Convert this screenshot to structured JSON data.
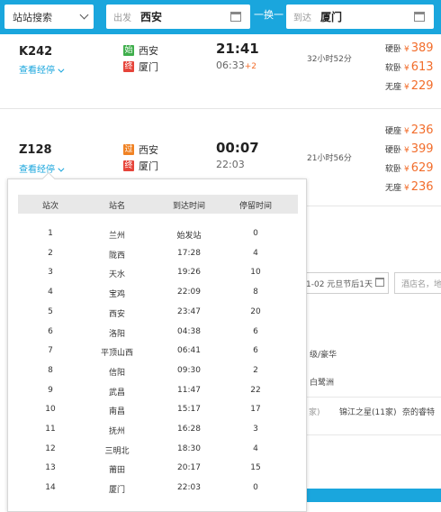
{
  "search": {
    "station_select": "站站搜索",
    "from_label": "出发",
    "from_city": "西安",
    "swap_label": "一换一",
    "to_label": "到达",
    "to_city": "厦门"
  },
  "trains": [
    {
      "code": "K242",
      "stops_link": "查看经停",
      "dep_badge": "始",
      "dep_badge_type": "start",
      "dep_station": "西安",
      "arr_badge": "终",
      "arr_station": "厦门",
      "dep_time": "21:41",
      "arr_time": "06:33",
      "day_offset": "+2",
      "duration": "32小时52分",
      "prices": [
        {
          "seat": "硬卧",
          "yen": "¥",
          "amount": "389"
        },
        {
          "seat": "软卧",
          "yen": "¥",
          "amount": "613"
        },
        {
          "seat": "无座",
          "yen": "¥",
          "amount": "229"
        }
      ]
    },
    {
      "code": "Z128",
      "stops_link": "查看经停",
      "dep_badge": "过",
      "dep_badge_type": "pass",
      "dep_station": "西安",
      "arr_badge": "终",
      "arr_station": "厦门",
      "dep_time": "00:07",
      "arr_time": "22:03",
      "day_offset": "",
      "duration": "21小时56分",
      "prices": [
        {
          "seat": "硬座",
          "yen": "¥",
          "amount": "236"
        },
        {
          "seat": "硬卧",
          "yen": "¥",
          "amount": "399"
        },
        {
          "seat": "软卧",
          "yen": "¥",
          "amount": "629"
        },
        {
          "seat": "无座",
          "yen": "¥",
          "amount": "236"
        }
      ]
    }
  ],
  "stops_popup": {
    "headers": [
      "站次",
      "站名",
      "到达时间",
      "停留时间"
    ],
    "rows": [
      [
        "1",
        "兰州",
        "始发站",
        "0"
      ],
      [
        "2",
        "陇西",
        "17:28",
        "4"
      ],
      [
        "3",
        "天水",
        "19:26",
        "10"
      ],
      [
        "4",
        "宝鸡",
        "22:09",
        "8"
      ],
      [
        "5",
        "西安",
        "23:47",
        "20"
      ],
      [
        "6",
        "洛阳",
        "04:38",
        "6"
      ],
      [
        "7",
        "平顶山西",
        "06:41",
        "6"
      ],
      [
        "8",
        "信阳",
        "09:30",
        "2"
      ],
      [
        "9",
        "武昌",
        "11:47",
        "22"
      ],
      [
        "10",
        "南昌",
        "15:17",
        "17"
      ],
      [
        "11",
        "抚州",
        "16:28",
        "3"
      ],
      [
        "12",
        "三明北",
        "18:30",
        "4"
      ],
      [
        "13",
        "莆田",
        "20:17",
        "15"
      ],
      [
        "14",
        "厦门",
        "22:03",
        "0"
      ]
    ]
  },
  "background": {
    "date_value": "1-02  元旦节后1天",
    "hotel_placeholder": "酒店名，地",
    "text_1": "级/豪华",
    "text_2": "白鹭洲",
    "text_3": "家)",
    "text_4": "锦江之星(11家)",
    "text_5": "奈的睿特"
  },
  "colors": {
    "accent": "#1aa6dd",
    "price": "#f26d2b",
    "badge_start": "#3fae4c",
    "badge_pass": "#f08224",
    "badge_end": "#e6443a"
  }
}
